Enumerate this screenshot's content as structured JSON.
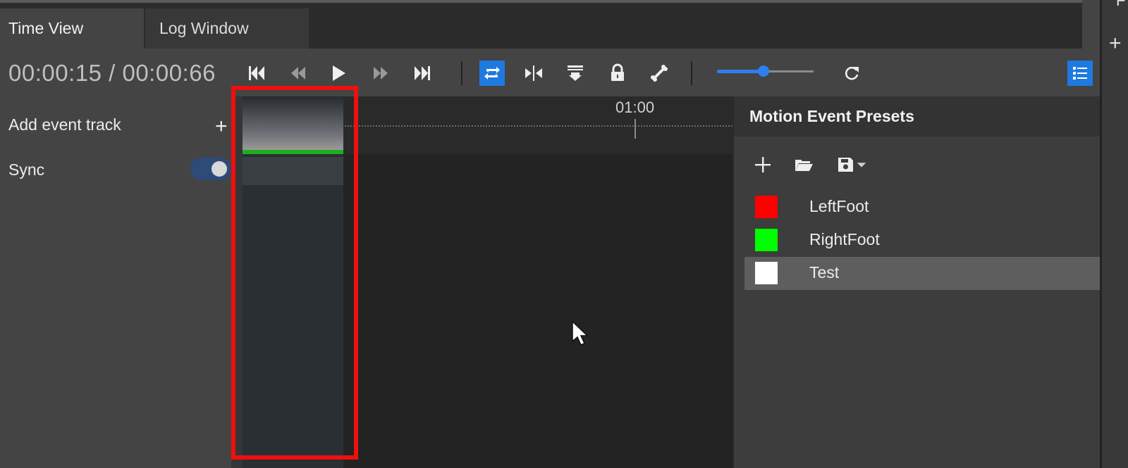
{
  "tabs": [
    {
      "label": "Time View",
      "active": true
    },
    {
      "label": "Log Window",
      "active": false
    }
  ],
  "toolbar": {
    "timecode": "00:00:15 / 00:00:66",
    "buttons": [
      {
        "icon": "skip-to-start-icon"
      },
      {
        "icon": "step-back-icon"
      },
      {
        "icon": "play-icon"
      },
      {
        "icon": "step-forward-icon"
      },
      {
        "icon": "skip-to-end-icon"
      },
      {
        "icon": "loop-icon",
        "active": true
      },
      {
        "icon": "mirror-icon"
      },
      {
        "icon": "insert-icon"
      },
      {
        "icon": "lock-icon"
      },
      {
        "icon": "bone-icon"
      },
      {
        "icon": "reset-icon"
      },
      {
        "icon": "list-view-icon",
        "active": true
      }
    ],
    "zoom_slider_value": 0.48,
    "accent_color": "#1f7ae0"
  },
  "left_panel": {
    "add_event_track_label": "Add event track",
    "sync_label": "Sync",
    "sync_enabled": true
  },
  "timeline": {
    "ruler_label": "01:00",
    "track_bar_color": "#1eae1e",
    "highlight_color": "#ee1010"
  },
  "presets_panel": {
    "title": "Motion Event Presets",
    "presets": [
      {
        "name": "LeftFoot",
        "color": "#ff0000",
        "selected": false
      },
      {
        "name": "RightFoot",
        "color": "#00ff00",
        "selected": false
      },
      {
        "name": "Test",
        "color": "#ffffff",
        "selected": true
      }
    ]
  },
  "right_edge": {
    "partial_text": "F"
  }
}
